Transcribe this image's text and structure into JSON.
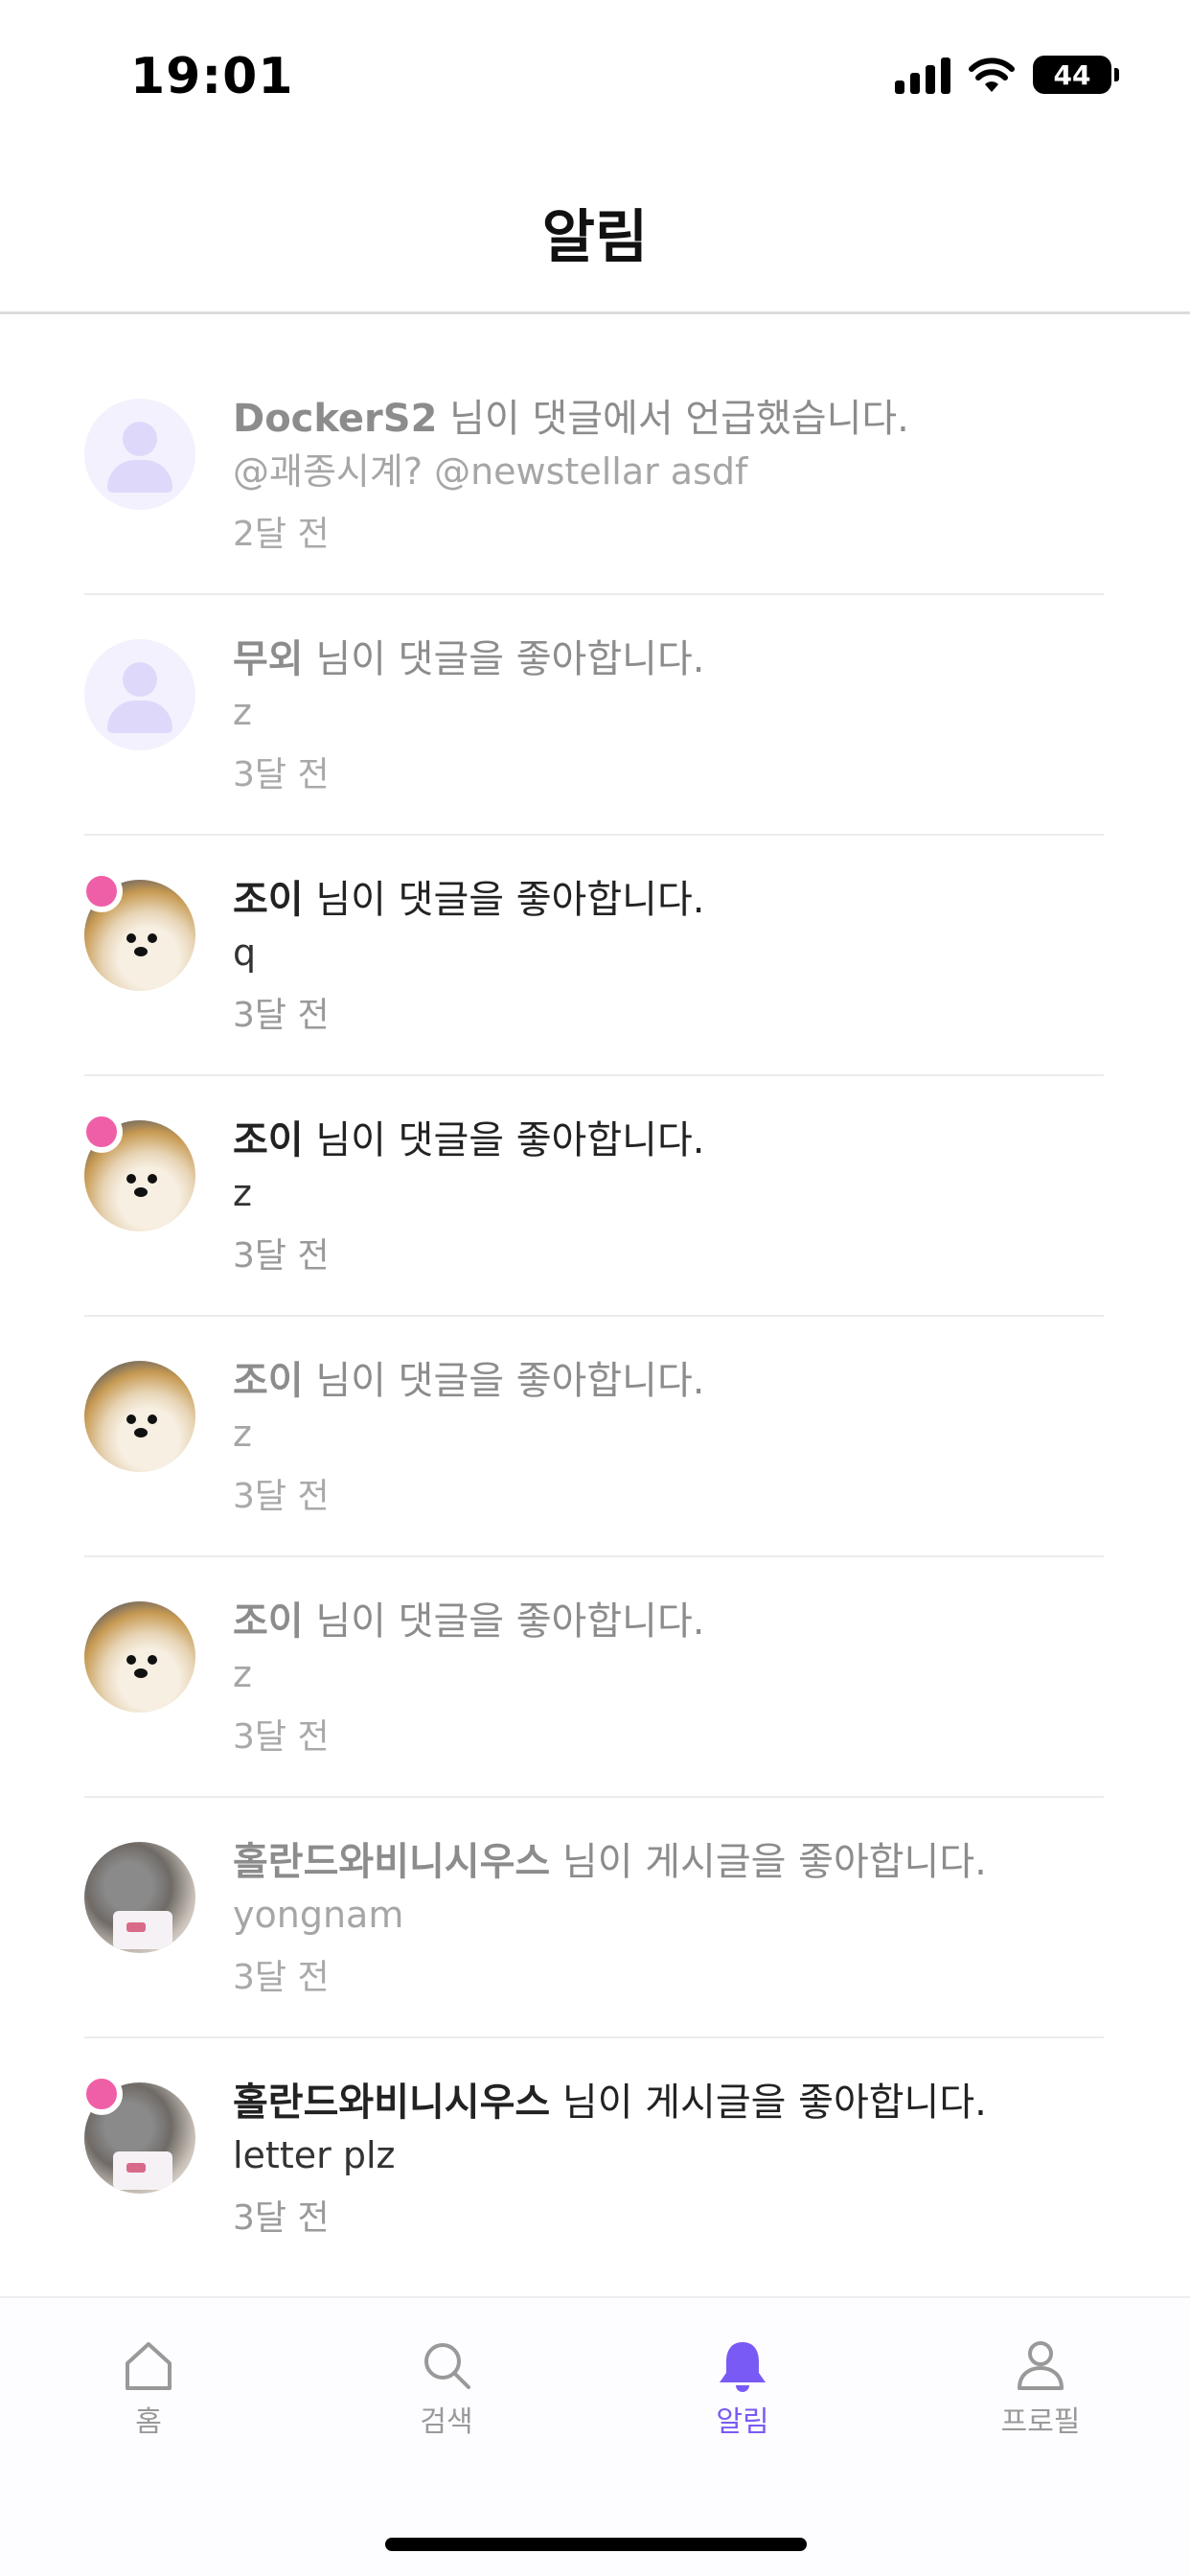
{
  "status_bar": {
    "time": "19:01",
    "battery": "44"
  },
  "header": {
    "title": "알림"
  },
  "notifications": [
    {
      "name": "DockerS2",
      "action": " 님이 댓글에서 언급했습니다.",
      "sub": "@괘종시계? @newstellar asdf",
      "time": "2달 전",
      "avatar": "default-avatar",
      "unread": false
    },
    {
      "name": "무외",
      "action": " 님이 댓글을 좋아합니다.",
      "sub": "z",
      "time": "3달 전",
      "avatar": "default-avatar",
      "unread": false
    },
    {
      "name": "조이",
      "action": " 님이 댓글을 좋아합니다.",
      "sub": "q",
      "time": "3달 전",
      "avatar": "dog-photo",
      "unread": true
    },
    {
      "name": "조이",
      "action": " 님이 댓글을 좋아합니다.",
      "sub": "z",
      "time": "3달 전",
      "avatar": "dog-photo",
      "unread": true
    },
    {
      "name": "조이",
      "action": " 님이 댓글을 좋아합니다.",
      "sub": "z",
      "time": "3달 전",
      "avatar": "dog-photo",
      "unread": false
    },
    {
      "name": "조이",
      "action": " 님이 댓글을 좋아합니다.",
      "sub": "z",
      "time": "3달 전",
      "avatar": "dog-photo",
      "unread": false
    },
    {
      "name": "홀란드와비니시우스",
      "action": " 님이 게시글을 좋아합니다.",
      "sub": "yongnam",
      "time": "3달 전",
      "avatar": "cat-photo",
      "unread": false
    },
    {
      "name": "홀란드와비니시우스",
      "action": " 님이 게시글을 좋아합니다.",
      "sub": "letter plz",
      "time": "3달 전",
      "avatar": "cat-photo",
      "unread": true
    }
  ],
  "tab_bar": {
    "active_color": "#7a5af5",
    "inactive_color": "#999999",
    "unread_dot_color": "#ef5fa7",
    "tabs": [
      {
        "label": "홈",
        "icon": "home-icon"
      },
      {
        "label": "검색",
        "icon": "search-icon"
      },
      {
        "label": "알림",
        "icon": "bell-icon",
        "active": true
      },
      {
        "label": "프로필",
        "icon": "person-icon"
      }
    ]
  }
}
